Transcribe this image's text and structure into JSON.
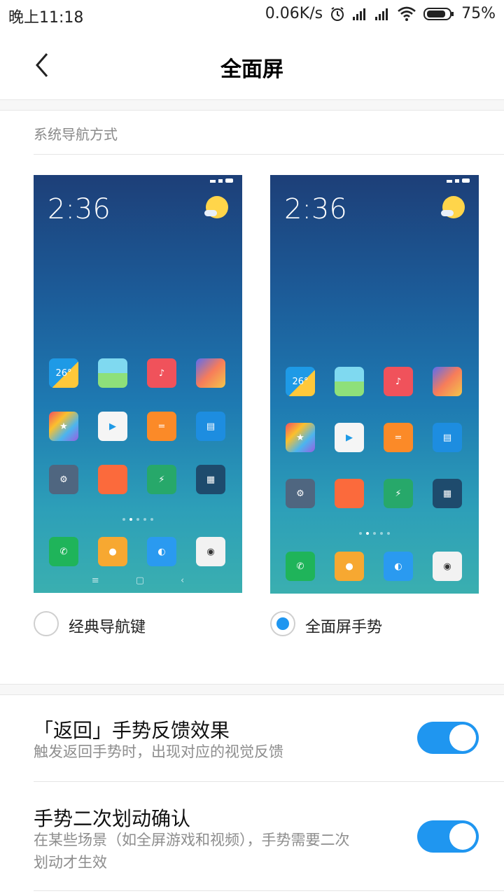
{
  "status_bar": {
    "time": "晚上11:18",
    "net_speed": "0.06K/s",
    "battery": "75%"
  },
  "header": {
    "title": "全面屏",
    "back_icon": "chevron-left-icon"
  },
  "nav_section": {
    "label": "系统导航方式",
    "preview_clock": "2:36",
    "weather_temp": "26°",
    "options": [
      {
        "label": "经典导航键",
        "selected": false
      },
      {
        "label": "全面屏手势",
        "selected": true
      }
    ]
  },
  "settings": [
    {
      "title": "「返回」手势反馈效果",
      "subtitle": "触发返回手势时，出现对应的视觉反馈",
      "enabled": true
    },
    {
      "title": "手势二次划动确认",
      "subtitle": "在某些场景（如全屏游戏和视频），手势需要二次划动才生效",
      "enabled": true
    }
  ],
  "colors": {
    "accent": "#1f96f0"
  }
}
